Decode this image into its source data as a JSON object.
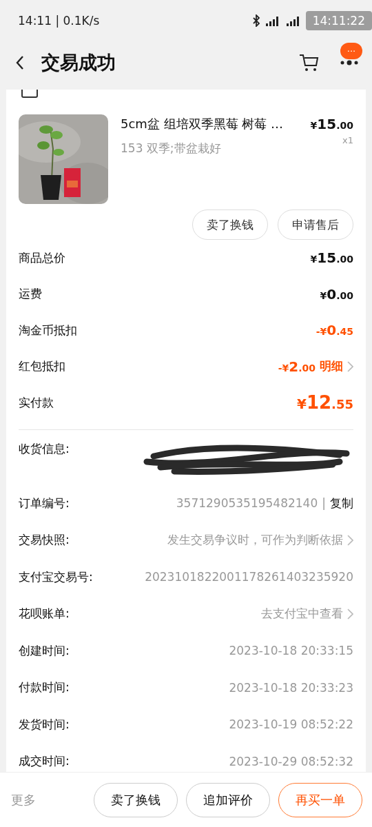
{
  "status_bar": {
    "time": "14:11 | 0.1K/s",
    "clock_overlay": "14:11:22"
  },
  "header": {
    "title": "交易成功",
    "badge": "···"
  },
  "product": {
    "title": "5cm盆 组培双季黑莓 树莓 …",
    "spec": "153 双季;带盆栽好",
    "price": "¥15.00",
    "quantity": "x1",
    "image": {
      "kind": "picture"
    },
    "actions": [
      "卖了换钱",
      "申请售后"
    ]
  },
  "price_rows": [
    {
      "label": "商品总价",
      "amount": "¥15.00",
      "highlight": false,
      "large": false
    },
    {
      "label": "运费",
      "amount": "¥0.00",
      "highlight": false,
      "large": false
    },
    {
      "label": "淘金币抵扣",
      "amount": "-¥0.45",
      "highlight": true,
      "large": false
    },
    {
      "label": "红包抵扣",
      "amount": "-¥2.00",
      "highlight": true,
      "large": false,
      "link": "明细"
    },
    {
      "label": "实付款",
      "amount": "¥12.55",
      "highlight": true,
      "large": true
    }
  ],
  "info_rows": [
    {
      "kind": "redacted",
      "label": "收货信息:"
    },
    {
      "kind": "text",
      "label": "订单编号:",
      "value": "3571290535195482140",
      "separator": "|",
      "action": "复制",
      "chevron": false
    },
    {
      "kind": "text",
      "label": "交易快照:",
      "value": "发生交易争议时，可作为判断依据",
      "chevron": true
    },
    {
      "kind": "text",
      "label": "支付宝交易号:",
      "value": "2023101822001178261403235920",
      "chevron": false
    },
    {
      "kind": "text",
      "label": "花呗账单:",
      "value": "去支付宝中查看",
      "chevron": true
    },
    {
      "kind": "text",
      "label": "创建时间:",
      "value": "2023-10-18 20:33:15",
      "chevron": false
    },
    {
      "kind": "text",
      "label": "付款时间:",
      "value": "2023-10-18 20:33:23",
      "chevron": false
    },
    {
      "kind": "text",
      "label": "发货时间:",
      "value": "2023-10-19 08:52:22",
      "chevron": false
    },
    {
      "kind": "text",
      "label": "成交时间:",
      "value": "2023-10-29 08:52:32",
      "chevron": false
    }
  ],
  "bottom_bar": {
    "more": "更多",
    "buttons": [
      {
        "label": "卖了换钱",
        "primary": false
      },
      {
        "label": "追加评价",
        "primary": false
      },
      {
        "label": "再买一单",
        "primary": true
      }
    ]
  }
}
